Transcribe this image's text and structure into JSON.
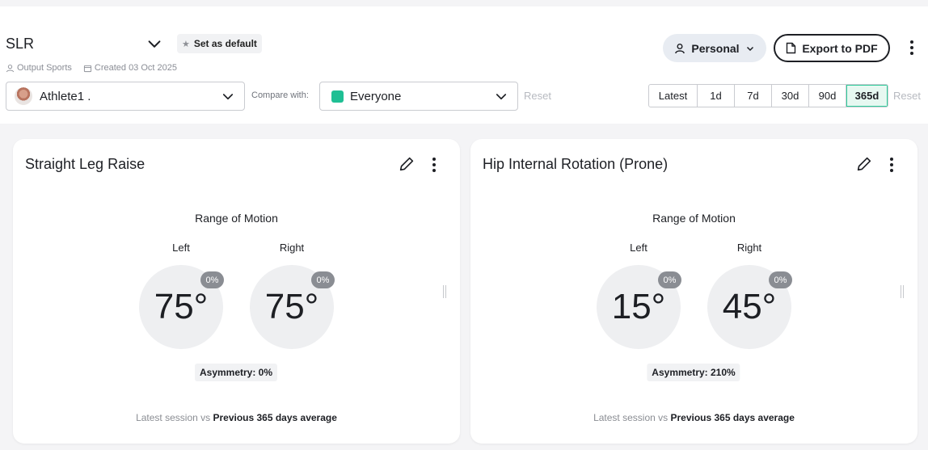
{
  "header": {
    "title": "SLR",
    "set_default_label": "Set as default",
    "org": "Output Sports",
    "created": "Created 03 Oct 2025",
    "personal_label": "Personal",
    "export_label": "Export to PDF"
  },
  "filters": {
    "athlete": "Athlete1 .",
    "compare_label": "Compare with:",
    "compare_value": "Everyone",
    "compare_color": "#1fbf94",
    "reset_label": "Reset",
    "time_options": [
      "Latest",
      "1d",
      "7d",
      "30d",
      "90d",
      "365d"
    ],
    "time_selected": "365d",
    "accent_color": "#2fcc9b"
  },
  "cards": [
    {
      "title": "Straight Leg Raise",
      "metric": "Range of Motion",
      "left_label": "Left",
      "right_label": "Right",
      "left_value": "75°",
      "right_value": "75°",
      "left_change": "0%",
      "right_change": "0%",
      "asymmetry": "Asymmetry: 0%",
      "footnote_prefix": "Latest session vs",
      "footnote_bold": "Previous 365 days average"
    },
    {
      "title": "Hip Internal Rotation (Prone)",
      "metric": "Range of Motion",
      "left_label": "Left",
      "right_label": "Right",
      "left_value": "15°",
      "right_value": "45°",
      "left_change": "0%",
      "right_change": "0%",
      "asymmetry": "Asymmetry: 210%",
      "footnote_prefix": "Latest session vs",
      "footnote_bold": "Previous 365 days average"
    }
  ]
}
